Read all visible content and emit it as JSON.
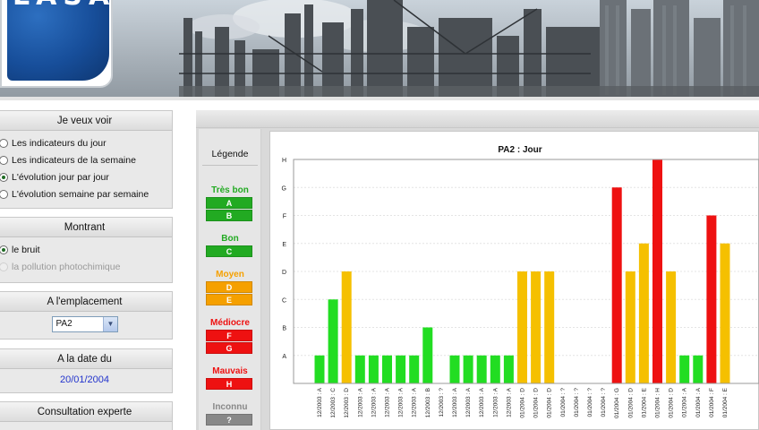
{
  "header": {
    "logo_text": "LASA"
  },
  "sidebar": {
    "view_panel": {
      "title": "Je veux voir",
      "options": [
        {
          "label": "Les indicateurs du jour",
          "checked": false
        },
        {
          "label": "Les indicateurs de la semaine",
          "checked": false
        },
        {
          "label": "L'évolution jour par jour",
          "checked": true
        },
        {
          "label": "L'évolution semaine par semaine",
          "checked": false
        }
      ]
    },
    "show_panel": {
      "title": "Montrant",
      "options": [
        {
          "label": "le bruit",
          "checked": true,
          "disabled": false
        },
        {
          "label": "la pollution photochimique",
          "checked": false,
          "disabled": true
        }
      ]
    },
    "location_panel": {
      "title": "A l'emplacement",
      "selected": "PA2"
    },
    "date_panel": {
      "title": "A la date du",
      "value": "20/01/2004"
    },
    "expert_panel": {
      "title": "Consultation experte"
    }
  },
  "legend": {
    "title": "Légende",
    "groups": [
      {
        "label": "Très bon",
        "color": "#22aa22",
        "codes": [
          "A",
          "B"
        ]
      },
      {
        "label": "Bon",
        "color": "#22aa22",
        "codes": [
          "C"
        ]
      },
      {
        "label": "Moyen",
        "color": "#f5a000",
        "codes": [
          "D",
          "E"
        ]
      },
      {
        "label": "Médiocre",
        "color": "#ee1111",
        "codes": [
          "F",
          "G"
        ]
      },
      {
        "label": "Mauvais",
        "color": "#ee1111",
        "codes": [
          "H"
        ]
      },
      {
        "label": "Inconnu",
        "color": "#888888",
        "codes": [
          "?"
        ]
      }
    ]
  },
  "chart_data": {
    "type": "bar",
    "title": "PA2 : Jour",
    "y_ticks": [
      "A",
      "B",
      "C",
      "D",
      "E",
      "F",
      "G",
      "H"
    ],
    "ylim": [
      0,
      8
    ],
    "colors": {
      "good": "#22dd22",
      "medium": "#f5c000",
      "bad": "#ee1111"
    },
    "categories": [
      "12/2003 : A",
      "12/2003 : C",
      "12/2003 : D",
      "12/2003 : A",
      "12/2003 : A",
      "12/2003 : A",
      "12/2003 : A",
      "12/2003 : A",
      "12/2003 : B",
      "12/2003 : ?",
      "12/2003 : A",
      "12/2003 : A",
      "12/2003 : A",
      "12/2003 : A",
      "12/2003 : A",
      "01/2004 : D",
      "01/2004 : D",
      "01/2004 : D",
      "01/2004 : ?",
      "01/2004 : ?",
      "01/2004 : ?",
      "01/2004 : ?",
      "01/2004 : G",
      "01/2004 : D",
      "01/2004 : E",
      "01/2004 : H",
      "01/2004 : D",
      "01/2004 : A",
      "01/2004 : A",
      "01/2004 : F",
      "01/2004 : E"
    ],
    "values": [
      1,
      3,
      4,
      1,
      1,
      1,
      1,
      1,
      2,
      0,
      1,
      1,
      1,
      1,
      1,
      4,
      4,
      4,
      0,
      0,
      0,
      0,
      7,
      4,
      5,
      8,
      4,
      1,
      1,
      6,
      5
    ],
    "levels": [
      "good",
      "good",
      "medium",
      "good",
      "good",
      "good",
      "good",
      "good",
      "good",
      "none",
      "good",
      "good",
      "good",
      "good",
      "good",
      "medium",
      "medium",
      "medium",
      "none",
      "none",
      "none",
      "none",
      "bad",
      "medium",
      "medium",
      "bad",
      "medium",
      "good",
      "good",
      "bad",
      "medium"
    ]
  }
}
